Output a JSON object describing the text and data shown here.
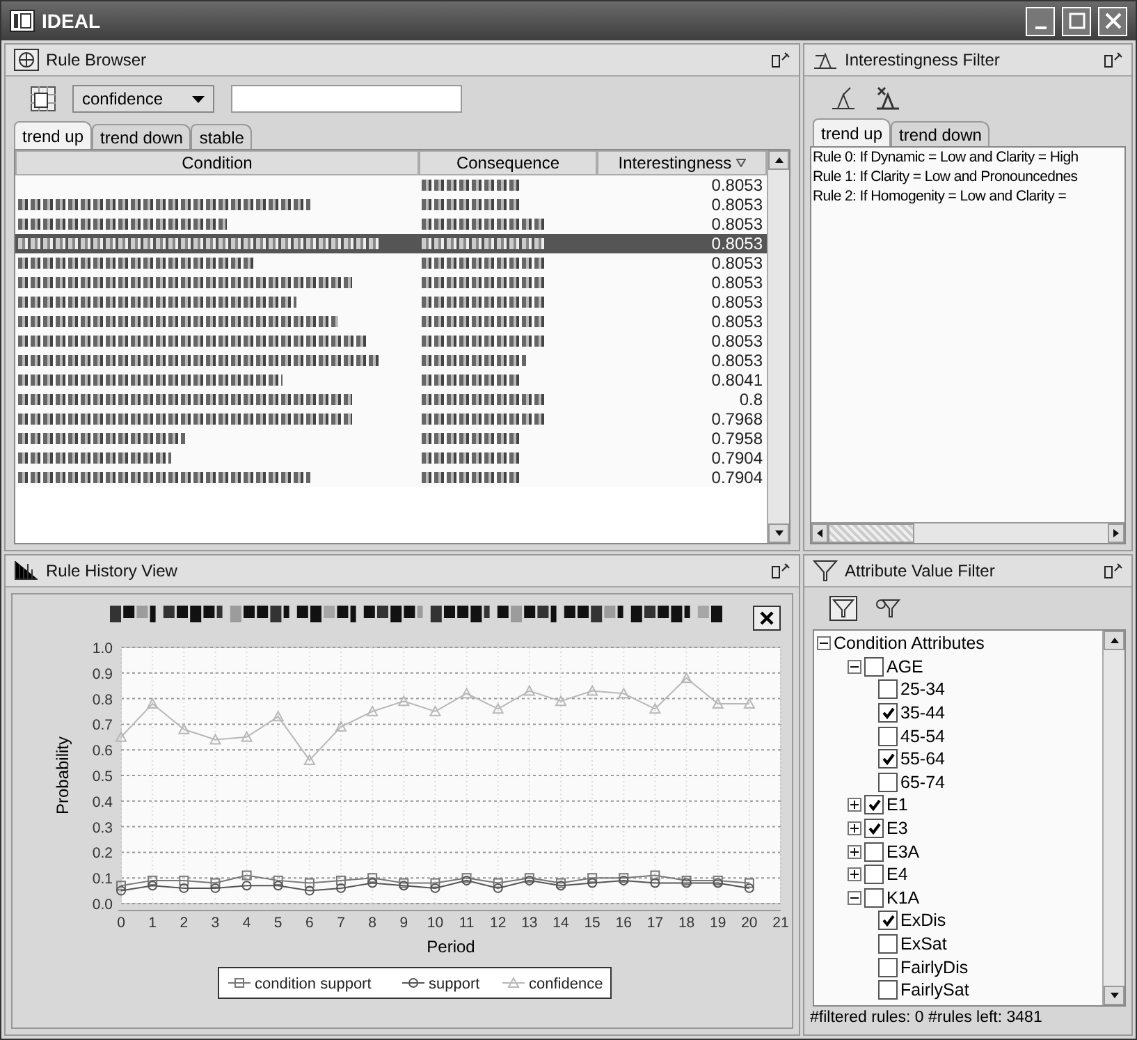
{
  "window": {
    "title": "IDEAL"
  },
  "rule_browser": {
    "title": "Rule Browser",
    "measure": "confidence",
    "tabs": [
      {
        "label": "trend up",
        "selected": true
      },
      {
        "label": "trend down",
        "selected": false
      },
      {
        "label": "stable",
        "selected": false
      }
    ],
    "columns": [
      "Condition",
      "Consequence",
      "Interestingness"
    ],
    "rows": [
      {
        "interestingness": "0.8053",
        "selected": false
      },
      {
        "interestingness": "0.8053",
        "selected": false
      },
      {
        "interestingness": "0.8053",
        "selected": false
      },
      {
        "interestingness": "0.8053",
        "selected": true
      },
      {
        "interestingness": "0.8053",
        "selected": false
      },
      {
        "interestingness": "0.8053",
        "selected": false
      },
      {
        "interestingness": "0.8053",
        "selected": false
      },
      {
        "interestingness": "0.8053",
        "selected": false
      },
      {
        "interestingness": "0.8053",
        "selected": false
      },
      {
        "interestingness": "0.8053",
        "selected": false
      },
      {
        "interestingness": "0.8041",
        "selected": false
      },
      {
        "interestingness": "0.8",
        "selected": false
      },
      {
        "interestingness": "0.7968",
        "selected": false
      },
      {
        "interestingness": "0.7958",
        "selected": false
      },
      {
        "interestingness": "0.7904",
        "selected": false
      },
      {
        "interestingness": "0.7904",
        "selected": false
      }
    ]
  },
  "interestingness_filter": {
    "title": "Interestingness Filter",
    "tabs": [
      {
        "label": "trend up",
        "selected": true
      },
      {
        "label": "trend down",
        "selected": false
      }
    ],
    "rules": [
      "Rule 0: If Dynamic = Low and Clarity = High",
      "Rule 1: If Clarity = Low and Pronouncednes",
      "Rule 2: If Homogenity = Low and Clarity ="
    ]
  },
  "rule_history": {
    "title": "Rule History View",
    "chart_data": {
      "type": "line",
      "xlabel": "Period",
      "ylabel": "Probability",
      "grid": true,
      "legend": true,
      "x": [
        0,
        1,
        2,
        3,
        4,
        5,
        6,
        7,
        8,
        9,
        10,
        11,
        12,
        13,
        14,
        15,
        16,
        17,
        18,
        19,
        20
      ],
      "xlim": [
        0,
        21
      ],
      "ylim": [
        0,
        1
      ],
      "xticks": [
        0,
        1,
        2,
        3,
        4,
        5,
        6,
        7,
        8,
        9,
        10,
        11,
        12,
        13,
        14,
        15,
        16,
        17,
        18,
        19,
        20,
        21
      ],
      "yticks": [
        {
          "value": 0,
          "label": "0.0"
        },
        {
          "value": 0.1,
          "label": "0.1"
        },
        {
          "value": 0.2,
          "label": "0.2"
        },
        {
          "value": 0.3,
          "label": "0.3"
        },
        {
          "value": 0.4,
          "label": "0.4"
        },
        {
          "value": 0.5,
          "label": "0.5"
        },
        {
          "value": 0.6,
          "label": "0.6"
        },
        {
          "value": 0.7,
          "label": "0.7"
        },
        {
          "value": 0.8,
          "label": "0.8"
        },
        {
          "value": 0.9,
          "label": "0.9"
        },
        {
          "value": 1,
          "label": "1.0"
        }
      ],
      "series": [
        {
          "name": "condition support",
          "color": "#777777",
          "marker": "square",
          "values": [
            0.07,
            0.09,
            0.09,
            0.08,
            0.11,
            0.09,
            0.08,
            0.09,
            0.1,
            0.08,
            0.08,
            0.1,
            0.08,
            0.1,
            0.08,
            0.1,
            0.1,
            0.11,
            0.09,
            0.09,
            0.08
          ]
        },
        {
          "name": "support",
          "color": "#555555",
          "marker": "circle",
          "values": [
            0.05,
            0.07,
            0.06,
            0.06,
            0.07,
            0.07,
            0.05,
            0.06,
            0.08,
            0.07,
            0.06,
            0.09,
            0.06,
            0.09,
            0.07,
            0.08,
            0.09,
            0.08,
            0.08,
            0.08,
            0.06
          ]
        },
        {
          "name": "confidence",
          "color": "#b8b8b8",
          "marker": "triangle",
          "values": [
            0.65,
            0.78,
            0.68,
            0.64,
            0.65,
            0.73,
            0.56,
            0.69,
            0.75,
            0.79,
            0.75,
            0.82,
            0.76,
            0.83,
            0.79,
            0.83,
            0.82,
            0.76,
            0.88,
            0.78,
            0.78
          ]
        }
      ]
    }
  },
  "attribute_filter": {
    "title": "Attribute Value Filter",
    "status": "#filtered rules: 0 #rules left: 3481",
    "tree": [
      {
        "label": "Condition Attributes",
        "kind": "group",
        "expanded": true,
        "children": [
          {
            "label": "AGE",
            "kind": "check",
            "checked": false,
            "expanded": true,
            "children": [
              {
                "label": "25-34",
                "kind": "check",
                "checked": false
              },
              {
                "label": "35-44",
                "kind": "check",
                "checked": true
              },
              {
                "label": "45-54",
                "kind": "check",
                "checked": false
              },
              {
                "label": "55-64",
                "kind": "check",
                "checked": true
              },
              {
                "label": "65-74",
                "kind": "check",
                "checked": false
              }
            ]
          },
          {
            "label": "E1",
            "kind": "check",
            "checked": true,
            "expanded": false
          },
          {
            "label": "E3",
            "kind": "check",
            "checked": true,
            "expanded": false
          },
          {
            "label": "E3A",
            "kind": "check",
            "checked": false,
            "expanded": false
          },
          {
            "label": "E4",
            "kind": "check",
            "checked": false,
            "expanded": false
          },
          {
            "label": "K1A",
            "kind": "check",
            "checked": false,
            "expanded": true,
            "children": [
              {
                "label": "ExDis",
                "kind": "check",
                "checked": true
              },
              {
                "label": "ExSat",
                "kind": "check",
                "checked": false
              },
              {
                "label": "FairlyDis",
                "kind": "check",
                "checked": false
              },
              {
                "label": "FairlySat",
                "kind": "check",
                "checked": false
              }
            ]
          }
        ]
      }
    ]
  }
}
